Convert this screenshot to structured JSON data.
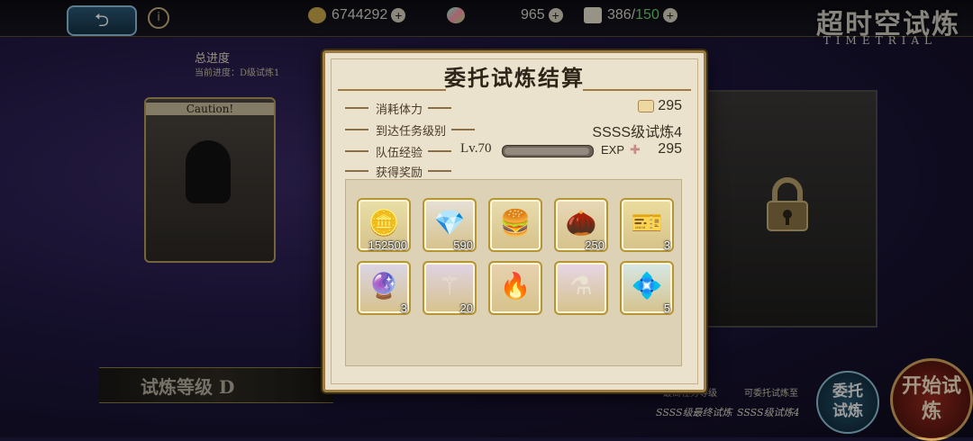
{
  "topbar": {
    "back_icon": "back-arrow-icon",
    "gold": "6744292",
    "gems": "965",
    "stamina": "386",
    "stamina_max": "150",
    "title_logo": "超时空试炼",
    "title_sub": "TIMETRIAL"
  },
  "background": {
    "progress_label": "总进度",
    "progress_current": "当前进度：D级试炼1",
    "caution": "Caution!",
    "level_label": "试炼等级 D",
    "bottom_info_1": "最高任务等级",
    "bottom_info_2": "可委托试炼至",
    "bottom_info_3": "SSSS级最终试炼",
    "bottom_info_4": "SSSS级试炼4",
    "commission_button": "委托试炼",
    "start_button": "开始试炼"
  },
  "modal": {
    "title": "委托试炼结算",
    "stamina_label": "消耗体力",
    "stamina_value": "295",
    "mission_label": "到达任务级别",
    "mission_value": "SSSS级试炼4",
    "exp_label": "队伍经验",
    "exp_level": "Lv.70",
    "exp_text": "EXP",
    "exp_value": "295",
    "exp_fill": 0.98,
    "reward_label": "获得奖励"
  },
  "rewards": [
    {
      "name": "gold-coin-icon",
      "glyph": "🪙",
      "qty": "152500",
      "bg": "#e9dfa8"
    },
    {
      "name": "rainbow-crystal-icon",
      "glyph": "💎",
      "qty": "590",
      "bg": "#e6e0d8"
    },
    {
      "name": "burger-icon",
      "glyph": "🍔",
      "qty": "",
      "bg": "#e8dcae"
    },
    {
      "name": "red-seed-icon",
      "glyph": "🌰",
      "qty": "250",
      "bg": "#e7d8b8"
    },
    {
      "name": "ticket-card-icon",
      "glyph": "🎫",
      "qty": "3",
      "bg": "#ebdd9e"
    },
    {
      "name": "blue-staff-icon",
      "glyph": "🔮",
      "qty": "3",
      "bg": "#dbd5e8"
    },
    {
      "name": "dark-scepter-icon",
      "glyph": "⚚",
      "qty": "20",
      "bg": "#e0d3e6"
    },
    {
      "name": "fire-emblem-icon",
      "glyph": "🔥",
      "qty": "",
      "bg": "#e8d2b0"
    },
    {
      "name": "potion-flask-icon",
      "glyph": "⚗",
      "qty": "",
      "bg": "#e6d6e8"
    },
    {
      "name": "cyan-crystal-icon",
      "glyph": "💠",
      "qty": "5",
      "bg": "#d6e8e8"
    }
  ]
}
